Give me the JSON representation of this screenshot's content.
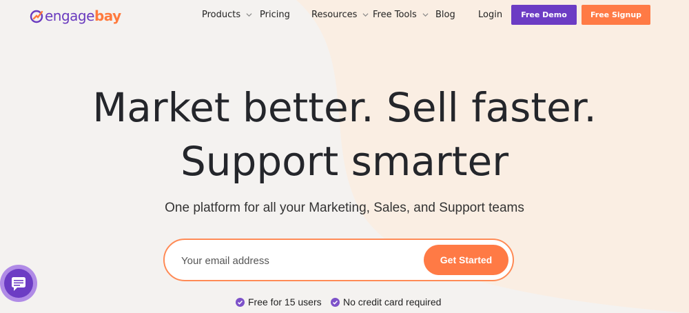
{
  "logo": {
    "part1": "engage",
    "part2": "bay"
  },
  "nav": {
    "items": [
      {
        "label": "Products",
        "dropdown": true
      },
      {
        "label": "Pricing",
        "dropdown": false
      },
      {
        "label": "Resources",
        "dropdown": true
      },
      {
        "label": "Free Tools",
        "dropdown": true
      },
      {
        "label": "Blog",
        "dropdown": false
      },
      {
        "label": "Login",
        "dropdown": false
      }
    ],
    "demo_button": "Free Demo",
    "signup_button": "Free Signup"
  },
  "hero": {
    "headline_line1": "Market better. Sell faster.",
    "headline_line2": "Support smarter",
    "subtitle": "One platform for all your Marketing, Sales, and Support teams",
    "email_placeholder": "Your email address",
    "cta": "Get Started",
    "features": [
      "Free for 15 users",
      "No credit card required"
    ]
  },
  "colors": {
    "brand_purple": "#6c3cc4",
    "brand_orange": "#ff7a45",
    "background": "#f5f3f1"
  },
  "icons": [
    "engagebay-logo-icon",
    "chevron-down-icon",
    "check-circle-icon",
    "chat-icon"
  ]
}
